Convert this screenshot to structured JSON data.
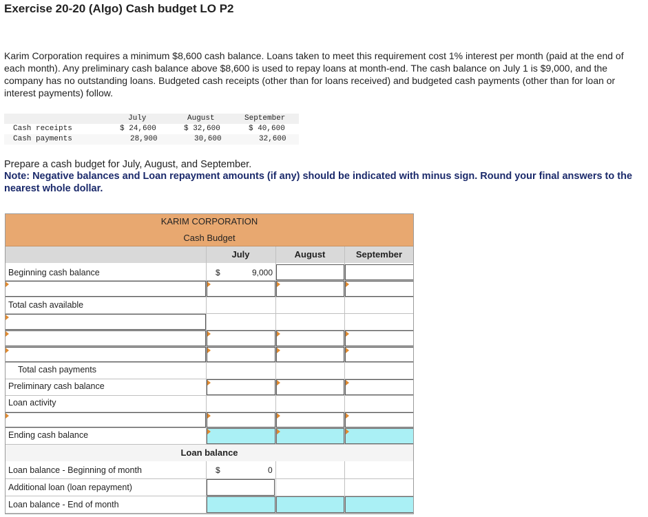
{
  "title": "Exercise 20-20 (Algo) Cash budget LO P2",
  "intro": "Karim Corporation requires a minimum $8,600 cash balance. Loans taken to meet this requirement cost 1% interest per month (paid at the end of each month). Any preliminary cash balance above $8,600 is used to repay loans at month-end. The cash balance on July 1 is $9,000, and the company has no outstanding loans. Budgeted cash receipts (other than for loans received) and budgeted cash payments (other than for loan or interest payments) follow.",
  "given": {
    "headers": [
      "July",
      "August",
      "September"
    ],
    "rows": [
      {
        "label": "Cash receipts",
        "values": [
          "$ 24,600",
          "$ 32,600",
          "$ 40,600"
        ]
      },
      {
        "label": "Cash payments",
        "values": [
          "28,900",
          "30,600",
          "32,600"
        ]
      }
    ]
  },
  "prompt": "Prepare a cash budget for July, August, and September.",
  "note": "Note: Negative balances and Loan repayment amounts (if any) should be indicated with minus sign. Round your final answers to the nearest whole dollar.",
  "budget": {
    "company": "KARIM CORPORATION",
    "subtitle": "Cash Budget",
    "columns": [
      "July",
      "August",
      "September"
    ],
    "labels": {
      "beginning": "Beginning cash balance",
      "total_available": "Total cash available",
      "total_payments": "Total cash payments",
      "preliminary": "Preliminary cash balance",
      "loan_activity": "Loan activity",
      "ending": "Ending cash balance"
    },
    "beginning_july": {
      "symbol": "$",
      "value": "9,000"
    },
    "loan_section": "Loan balance",
    "loan_labels": {
      "begin": "Loan balance - Beginning of month",
      "additional": "Additional loan (loan repayment)",
      "end": "Loan balance - End of month"
    },
    "loan_begin_july": {
      "symbol": "$",
      "value": "0"
    },
    "colors": {
      "band": "#e8a870",
      "computed": "#aaf0f5",
      "flag": "#e08a30",
      "note": "#1b2a6b"
    }
  }
}
